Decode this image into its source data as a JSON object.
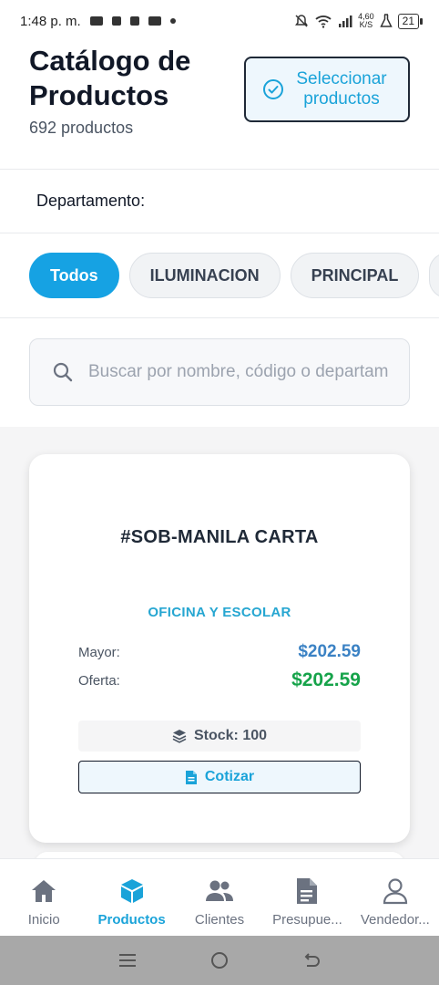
{
  "status_bar": {
    "time": "1:48 p. m.",
    "speed_value": "4,60",
    "speed_unit": "K/S",
    "battery": "21"
  },
  "header": {
    "title": "Catálogo de Productos",
    "product_count": "692 productos",
    "select_button_label": "Seleccionar productos"
  },
  "department": {
    "label": "Departamento:"
  },
  "chips": [
    {
      "label": "Todos",
      "active": true
    },
    {
      "label": "ILUMINACION",
      "active": false
    },
    {
      "label": "PRINCIPAL",
      "active": false
    }
  ],
  "search": {
    "placeholder": "Buscar por nombre, código o departamento",
    "value": ""
  },
  "product_card": {
    "name": "#SOB-MANILA CARTA",
    "department": "OFICINA Y ESCOLAR",
    "mayor_label": "Mayor:",
    "mayor_price": "$202.59",
    "oferta_label": "Oferta:",
    "oferta_price": "$202.59",
    "stock_text": "Stock: 100",
    "cotizar_label": "Cotizar"
  },
  "bottom_nav": {
    "items": [
      {
        "label": "Inicio",
        "icon": "home-icon",
        "active": false
      },
      {
        "label": "Productos",
        "icon": "box-icon",
        "active": true
      },
      {
        "label": "Clientes",
        "icon": "users-icon",
        "active": false
      },
      {
        "label": "Presupue...",
        "icon": "document-icon",
        "active": false
      },
      {
        "label": "Vendedor...",
        "icon": "user-icon",
        "active": false
      }
    ]
  },
  "colors": {
    "accent": "#16a2e3",
    "price_mayor": "#3b82c4",
    "price_oferta": "#16a34a"
  }
}
